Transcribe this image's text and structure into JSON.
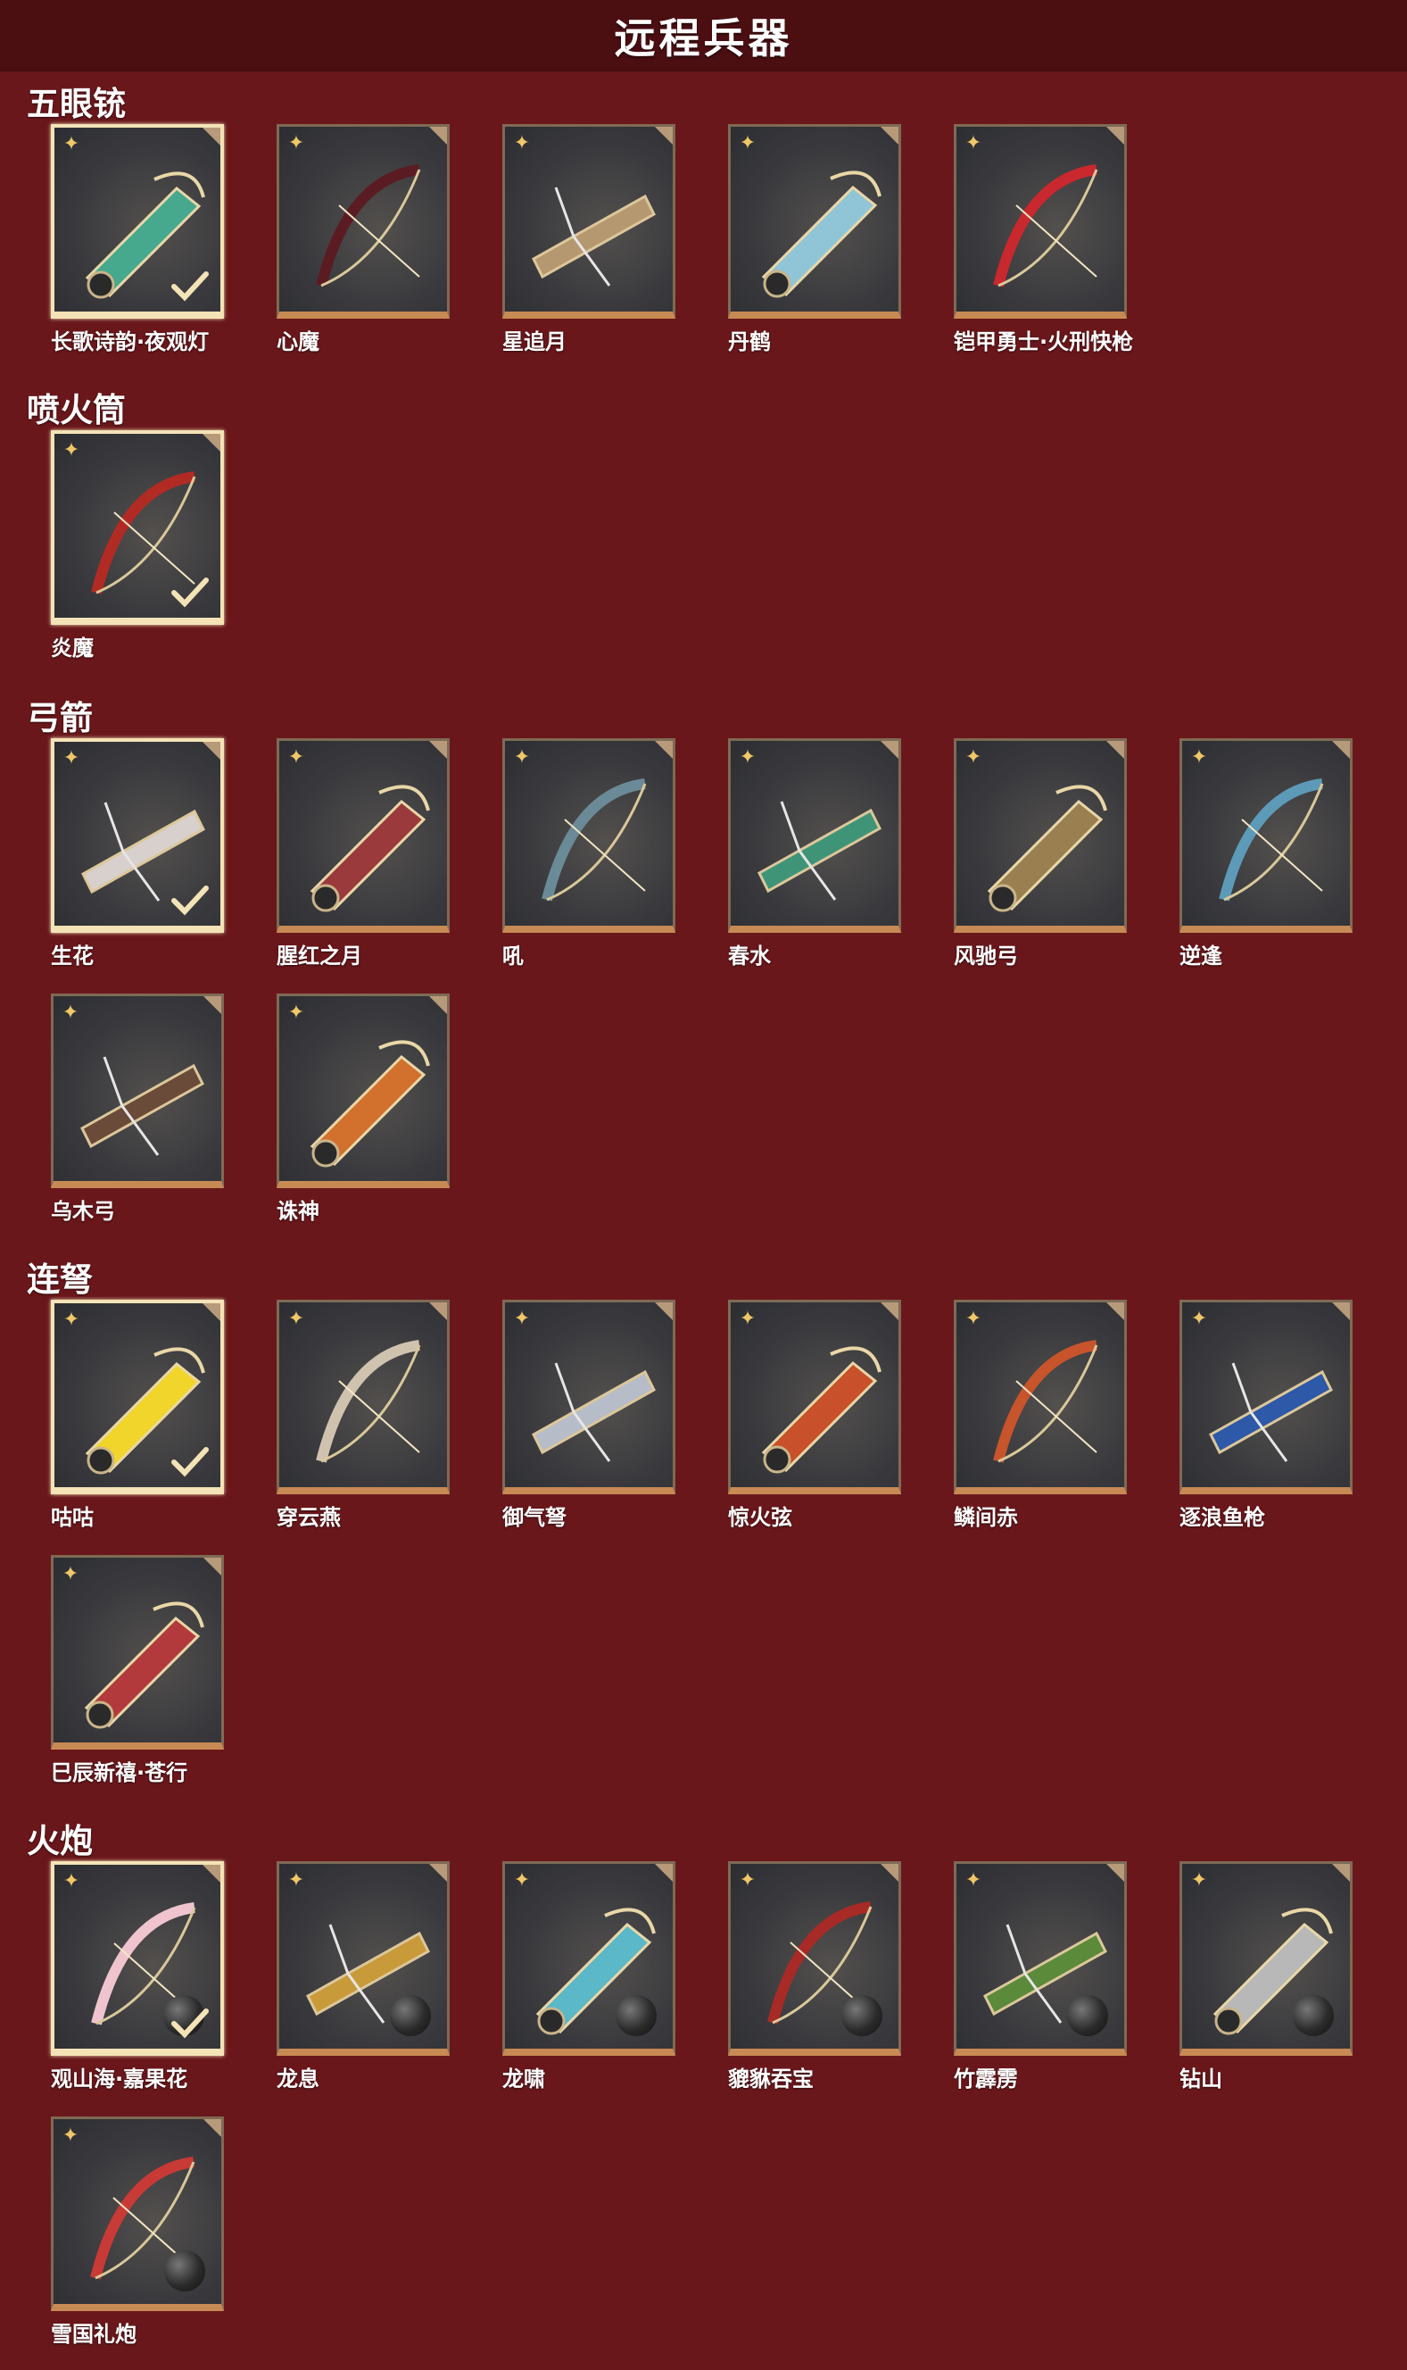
{
  "header": {
    "title": "远程兵器"
  },
  "sections": [
    {
      "title": "五眼铳",
      "items": [
        {
          "label": "长歌诗韵·夜观灯",
          "selected": true,
          "color": "#46a88c"
        },
        {
          "label": "心魔",
          "selected": false,
          "color": "#5a1c22"
        },
        {
          "label": "星追月",
          "selected": false,
          "color": "#b59870"
        },
        {
          "label": "丹鹤",
          "selected": false,
          "color": "#8fc5d6"
        },
        {
          "label": "铠甲勇士·火刑快枪",
          "selected": false,
          "color": "#c8282e"
        }
      ]
    },
    {
      "title": "喷火筒",
      "items": [
        {
          "label": "炎魔",
          "selected": true,
          "color": "#b22a24"
        }
      ]
    },
    {
      "title": "弓箭",
      "items": [
        {
          "label": "生花",
          "selected": true,
          "color": "#d8d0cc"
        },
        {
          "label": "腥红之月",
          "selected": false,
          "color": "#9a3a3c"
        },
        {
          "label": "吼",
          "selected": false,
          "color": "#6b8a98"
        },
        {
          "label": "春水",
          "selected": false,
          "color": "#3f9478"
        },
        {
          "label": "风驰弓",
          "selected": false,
          "color": "#9a8050"
        },
        {
          "label": "逆逢",
          "selected": false,
          "color": "#5c9ab8"
        },
        {
          "label": "乌木弓",
          "selected": false,
          "color": "#6a4a38"
        },
        {
          "label": "诛神",
          "selected": false,
          "color": "#d2702e"
        }
      ]
    },
    {
      "title": "连弩",
      "items": [
        {
          "label": "咕咕",
          "selected": true,
          "color": "#f1d52a"
        },
        {
          "label": "穿云燕",
          "selected": false,
          "color": "#cfc3b0"
        },
        {
          "label": "御气弩",
          "selected": false,
          "color": "#b6bcc8"
        },
        {
          "label": "惊火弦",
          "selected": false,
          "color": "#c8502a"
        },
        {
          "label": "鳞间赤",
          "selected": false,
          "color": "#c8542c"
        },
        {
          "label": "逐浪鱼枪",
          "selected": false,
          "color": "#2e58a8"
        },
        {
          "label": "巳辰新禧·苍行",
          "selected": false,
          "color": "#b23a3c"
        }
      ]
    },
    {
      "title": "火炮",
      "items": [
        {
          "label": "观山海·嘉果花",
          "selected": true,
          "color": "#efc4cf"
        },
        {
          "label": "龙息",
          "selected": false,
          "color": "#c89a3a"
        },
        {
          "label": "龙啸",
          "selected": false,
          "color": "#5ab8c8"
        },
        {
          "label": "貔貅吞宝",
          "selected": false,
          "color": "#a82a26"
        },
        {
          "label": "竹霹雳",
          "selected": false,
          "color": "#5a8a3a"
        },
        {
          "label": "钻山",
          "selected": false,
          "color": "#b8b8b8"
        },
        {
          "label": "雪国礼炮",
          "selected": false,
          "color": "#c83a36"
        }
      ]
    }
  ],
  "icons": {
    "star": "star-icon",
    "corner": "corner-tab-icon",
    "check": "check-icon",
    "cannonball": "cannonball-icon"
  }
}
